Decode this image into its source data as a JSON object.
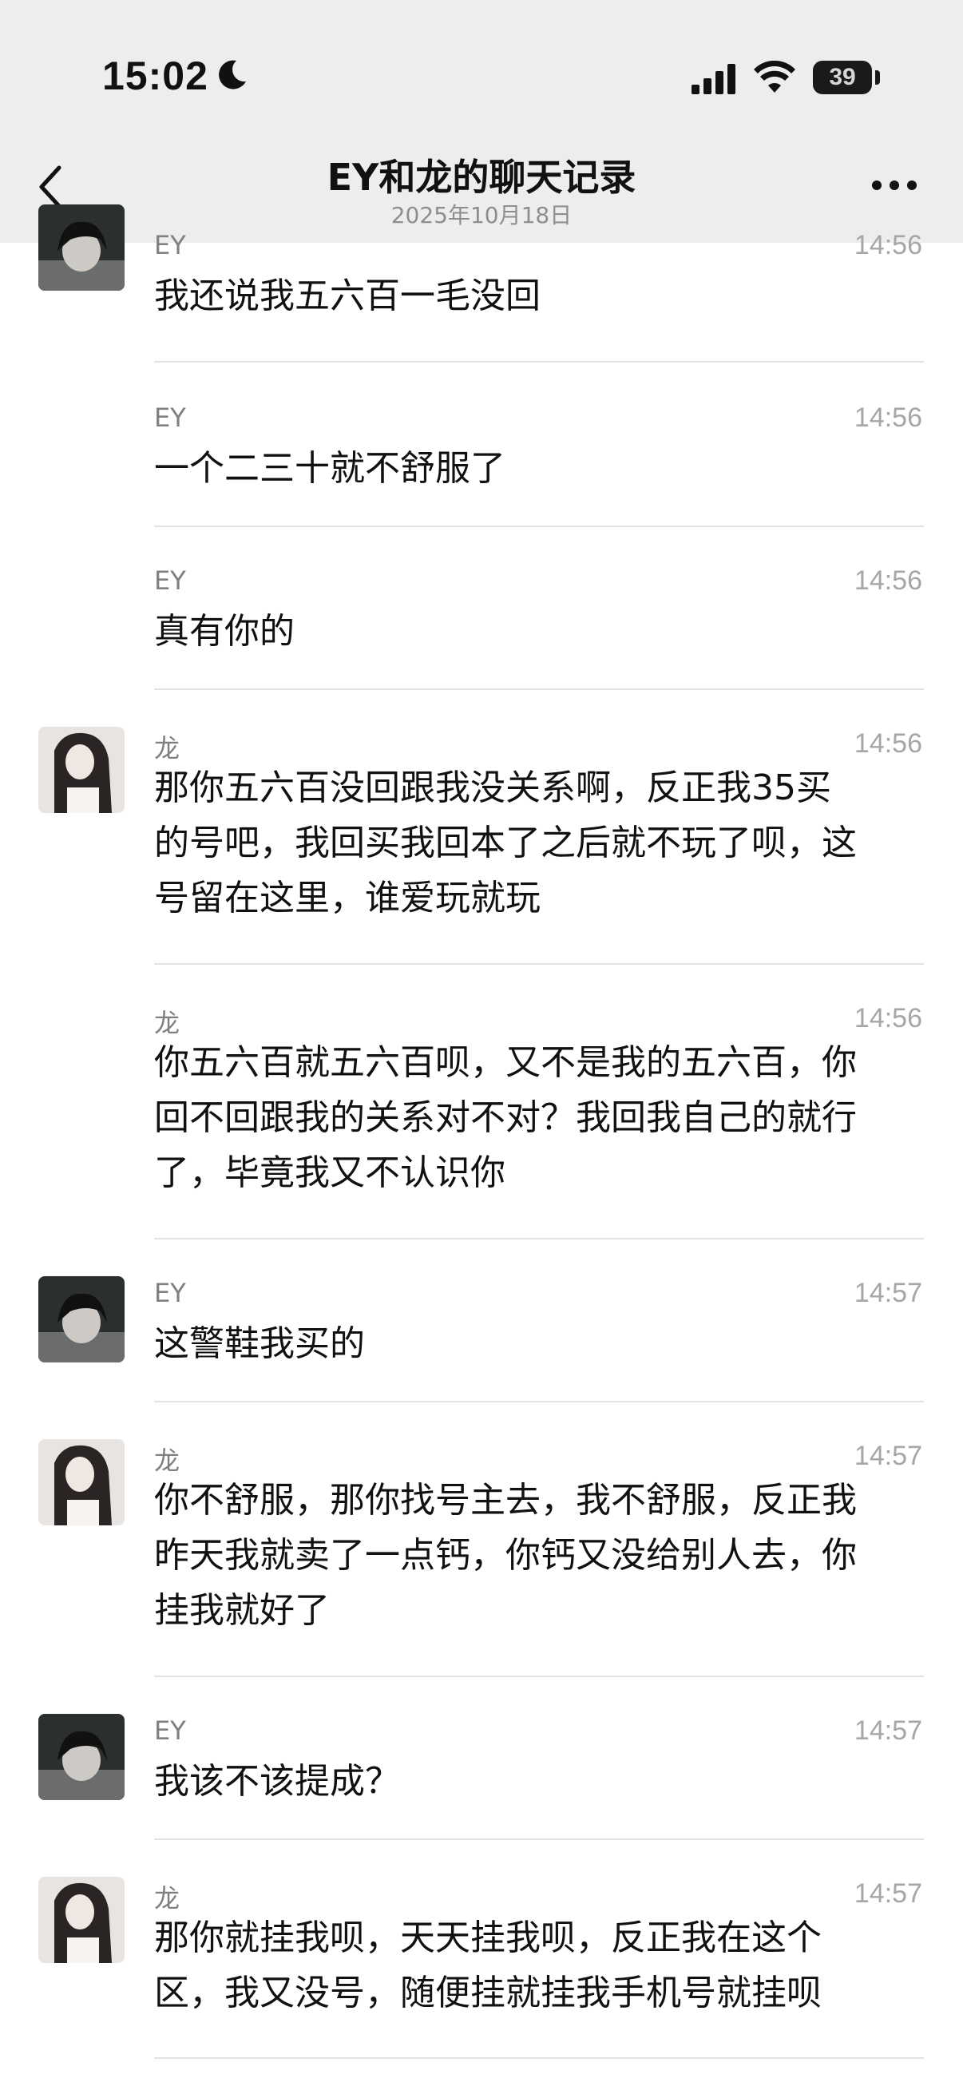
{
  "status_bar": {
    "time": "15:02",
    "battery": "39"
  },
  "header": {
    "title": "EY和龙的聊天记录",
    "subtitle": "2025年10月18日",
    "back_icon": "chevron-left-icon",
    "more_icon": "more-dots-icon"
  },
  "messages": [
    {
      "sender": "EY",
      "time": "14:56",
      "text": "我还说我五六百一毛没回",
      "avatar": "ey"
    },
    {
      "sender": "EY",
      "time": "14:56",
      "text": "一个二三十就不舒服了",
      "avatar": ""
    },
    {
      "sender": "EY",
      "time": "14:56",
      "text": "真有你的",
      "avatar": ""
    },
    {
      "sender": "龙",
      "time": "14:56",
      "lines": [
        "那你五六百没回跟我没关系啊，反正我35买",
        "的号吧，我回买我回本了之后就不玩了呗，这",
        "号留在这里，谁爱玩就玩"
      ],
      "avatar": "long"
    },
    {
      "sender": "龙",
      "time": "14:56",
      "lines": [
        "你五六百就五六百呗，又不是我的五六百，你",
        "回不回跟我的关系对不对？我回我自己的就行",
        "了，毕竟我又不认识你"
      ],
      "avatar": ""
    },
    {
      "sender": "EY",
      "time": "14:57",
      "text": "这警鞋我买的",
      "avatar": "ey"
    },
    {
      "sender": "龙",
      "time": "14:57",
      "lines": [
        "你不舒服，那你找号主去，我不舒服，反正我",
        "昨天我就卖了一点钙，你钙又没给别人去，你",
        "挂我就好了"
      ],
      "avatar": "long"
    },
    {
      "sender": "EY",
      "time": "14:57",
      "text": "我该不该提成？",
      "avatar": "ey"
    },
    {
      "sender": "龙",
      "time": "14:57",
      "lines": [
        "那你就挂我呗，天天挂我呗，反正我在这个",
        "区，我又没号，随便挂就挂我手机号就挂呗"
      ],
      "avatar": "long"
    }
  ]
}
